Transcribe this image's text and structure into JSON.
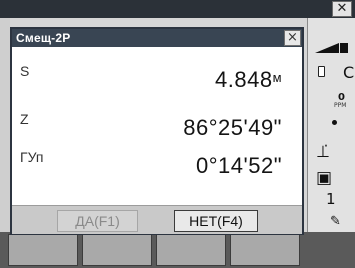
{
  "background_app": {
    "close_symbol": "✕",
    "sidebar": {
      "slot_value": "C",
      "ppm_value": "0",
      "ppm_unit": "PPM",
      "count_value": "1"
    }
  },
  "dialog": {
    "title": "Смещ-2Р",
    "close_symbol": "×",
    "rows": [
      {
        "label": "S",
        "value": "4.848",
        "unit": "м"
      },
      {
        "label": "Z",
        "value": "86°25'49\"",
        "unit": ""
      },
      {
        "label": "ГУп",
        "value": "0°14'52\"",
        "unit": ""
      }
    ],
    "buttons": {
      "yes_label": "ДА(F1)",
      "no_label": "НЕТ(F4)"
    }
  },
  "colors": {
    "title_bar": "#394553",
    "dialog_border": "#2c3440",
    "footer": "#c9c9c9"
  },
  "icons": [
    "battery-icon",
    "memory-slot-icon",
    "prism-icon",
    "camera-icon",
    "pen-icon"
  ]
}
